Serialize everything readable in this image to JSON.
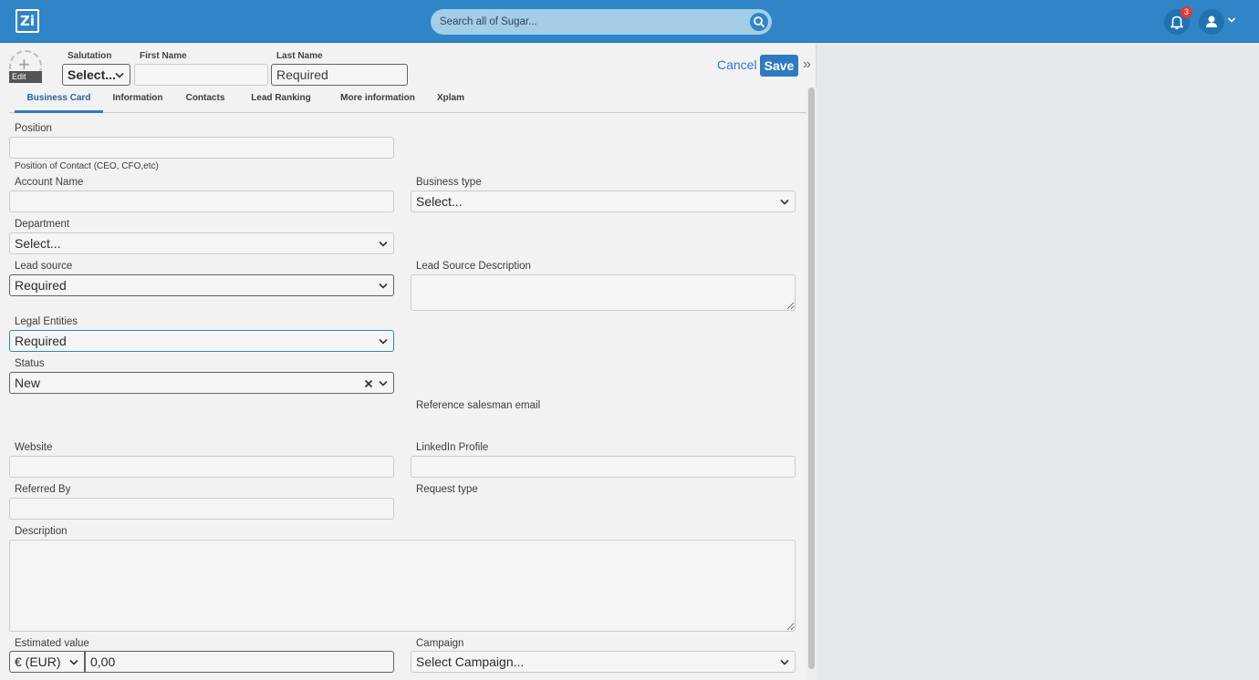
{
  "topbar": {
    "logo_text": "Zi",
    "search_placeholder": "Search all of Sugar...",
    "notification_count": "3"
  },
  "header": {
    "edit_label": "Edit",
    "salutation_label": "Salutation",
    "salutation_value": "Select...",
    "first_name_label": "First Name",
    "first_name_value": "",
    "last_name_label": "Last Name",
    "last_name_placeholder": "Required",
    "cancel_label": "Cancel",
    "save_label": "Save"
  },
  "tabs": [
    {
      "label": "Business Card",
      "active": true
    },
    {
      "label": "Information"
    },
    {
      "label": "Contacts"
    },
    {
      "label": "Lead Ranking"
    },
    {
      "label": "More information"
    },
    {
      "label": "Xplam"
    }
  ],
  "form": {
    "position_label": "Position",
    "position_help": "Position of Contact (CEO, CFO,etc)",
    "account_name_label": "Account Name",
    "business_type_label": "Business type",
    "business_type_value": "Select...",
    "department_label": "Department",
    "department_value": "Select...",
    "lead_source_label": "Lead source",
    "lead_source_value": "Required",
    "lead_source_description_label": "Lead Source Description",
    "legal_entities_label": "Legal Entities",
    "legal_entities_value": "Required",
    "status_label": "Status",
    "status_value": "New",
    "reference_salesman_email_label": "Reference salesman email",
    "website_label": "Website",
    "linkedin_label": "LinkedIn Profile",
    "referred_by_label": "Referred By",
    "request_type_label": "Request type",
    "description_label": "Description",
    "estimated_value_label": "Estimated value",
    "currency_value": "€ (EUR)",
    "estimated_value": "0,00",
    "campaign_label": "Campaign",
    "campaign_value": "Select Campaign..."
  },
  "colors": {
    "topbar": "#2f85c5",
    "save_button": "#2f7bbf",
    "badge": "#dd3b32"
  }
}
